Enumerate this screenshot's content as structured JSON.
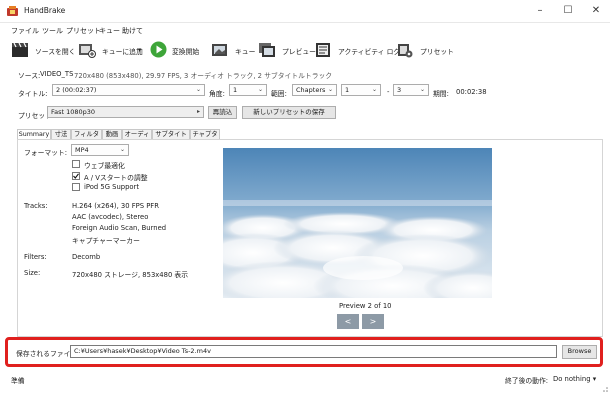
{
  "window": {
    "title": "HandBrake"
  },
  "menu": [
    "ファイル",
    "ツール",
    "プリセット",
    "キュー",
    "助けて"
  ],
  "toolbar": {
    "open_source": "ソースを開く",
    "add_queue": "キューに追加",
    "start": "変換開始",
    "queue": "キュー",
    "preview": "プレビュー",
    "activity": "アクティビティ ログ",
    "presets": "プリセット"
  },
  "source": {
    "label": "ソース:",
    "name": "VIDEO_TS",
    "info": "720x480 (853x480), 29.97 FPS, 3 オーディオ トラック, 2 サブタイトルトラック"
  },
  "title_row": {
    "title_label": "タイトル:",
    "title_value": "2 (00:02:37)",
    "angle_label": "角度:",
    "angle_value": "1",
    "range_label": "範囲:",
    "range_type": "Chapters",
    "range_start": "1",
    "range_sep": "-",
    "range_end": "3",
    "duration_label": "期間:",
    "duration_value": "00:02:38"
  },
  "preset_row": {
    "label": "プリセット",
    "value": "Fast 1080p30",
    "reload": "再読込",
    "save_new": "新しいプリセットの保存"
  },
  "tabs": [
    "Summary",
    "寸法",
    "フィルター",
    "動画",
    "オーディオ",
    "サブタイトル",
    "チャプター"
  ],
  "summary": {
    "format_label": "フォーマット:",
    "format_value": "MP4",
    "web_optimized": "ウェブ最適化",
    "web_optimized_checked": false,
    "av_align": "A / Vスタートの調整",
    "av_align_checked": true,
    "ipod": "iPod 5G Support",
    "ipod_checked": false,
    "tracks_label": "Tracks:",
    "tracks": [
      "H.264 (x264), 30 FPS PFR",
      "AAC (avcodec), Stereo",
      "Foreign Audio Scan, Burned",
      "キャプチャーマーカー"
    ],
    "filters_label": "Filters:",
    "filters_value": "Decomb",
    "size_label": "Size:",
    "size_value": "720x480 ストレージ, 853x480 表示"
  },
  "preview": {
    "caption": "Preview 2 of 10",
    "prev": "<",
    "next": ">"
  },
  "save": {
    "label": "保存されるファイル:",
    "path": "C:¥Users¥hasek¥Desktop¥Video Ts-2.m4v",
    "browse": "Browse"
  },
  "status": {
    "left": "準備",
    "after_label": "終了後の動作:",
    "after_value": "Do nothing"
  },
  "colors": {
    "highlight": "#e0201e",
    "start_green": "#3ea539",
    "nav_button": "#8d9aa6"
  }
}
